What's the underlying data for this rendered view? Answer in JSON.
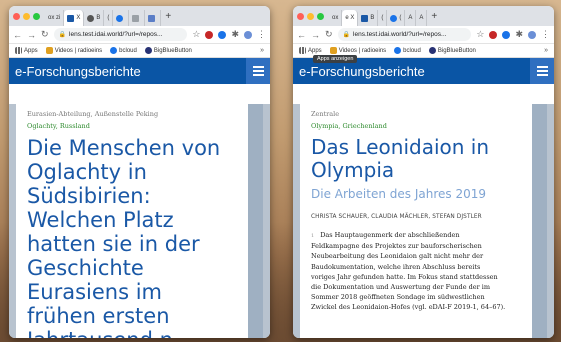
{
  "browser": {
    "address": "lens.test.idai.world/?url=/repos...",
    "bookmarks": {
      "apps": "Apps",
      "videos": "Videos | radioeins",
      "bcloud": "bcloud",
      "bbb": "BigBlueButton",
      "more": "»"
    },
    "apps_tooltip": "Apps anzeigen"
  },
  "window1": {
    "tabs": [
      "ox zi",
      "X",
      "B",
      "("
    ],
    "site_title": "e-Forschungsberichte",
    "crumb": "Eurasien-Abteilung, Außenstelle Peking",
    "place": "Oglachty, Russland",
    "title_lines": [
      "Die Menschen von",
      "Oglachty in",
      "Südsibirien:",
      "Welchen Platz",
      "hatten sie in der",
      "Geschichte",
      "Eurasiens im",
      "frühen ersten",
      "Jahrtausend n."
    ]
  },
  "window2": {
    "tabs": [
      "ox",
      "e X",
      "B",
      "(",
      "(",
      "A",
      "A"
    ],
    "site_title": "e-Forschungsberichte",
    "crumb": "Zentrale",
    "place": "Olympia, Griechenland",
    "title_lines": [
      "Das Leonidaion in",
      "Olympia"
    ],
    "subtitle": "Die Arbeiten des Jahres 2019",
    "authors": "CHRISTA SCHAUER, CLAUDIA MÄCHLER, STEFAN DJSTLER",
    "para_num": "1",
    "para_lines": [
      "Das Hauptaugenmerk der abschließenden",
      "Feldkampagne des Projektes zur bauforscherischen",
      "Neubearbeitung des Leonidaion galt nicht mehr der",
      "Baudokumentation, welche ihren Abschluss bereits",
      "voriges Jahr gefunden hatte. Im Fokus stand stattdessen",
      "die Dokumentation und Auswertung der Funde der im",
      "Sommer 2018 geöffneten Sondage im südwestlichen",
      "Zwickel des Leonidaion-Hofes (vgl. eDAI-F 2019-1, 64–67)."
    ]
  },
  "colors": {
    "header": "#0a55a5",
    "title": "#1a58a6",
    "place": "#2e8b2e"
  }
}
